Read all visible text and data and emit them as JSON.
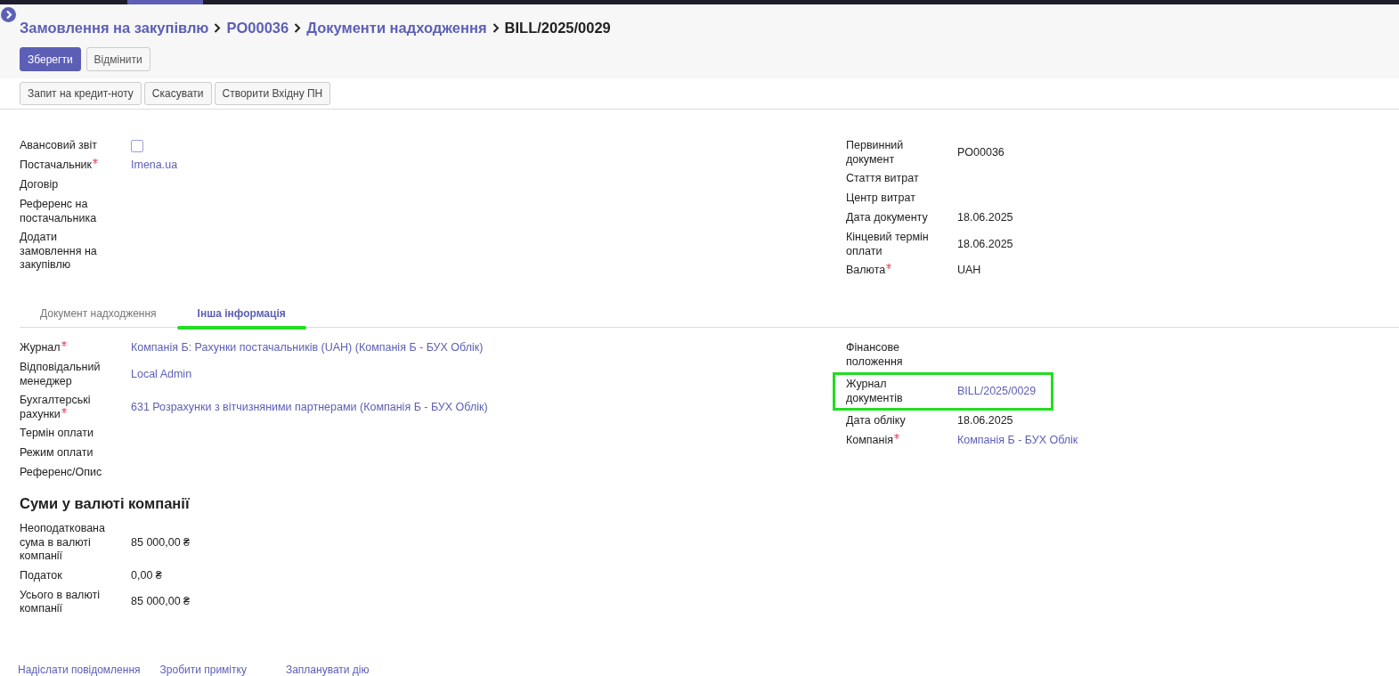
{
  "breadcrumbs": [
    {
      "label": "Замовлення на закупівлю",
      "kind": "link"
    },
    {
      "label": "PO00036",
      "kind": "link"
    },
    {
      "label": "Документи надходження",
      "kind": "link"
    },
    {
      "label": "BILL/2025/0029",
      "kind": "current"
    }
  ],
  "buttons": [
    {
      "label": "Зберегти",
      "primary": true
    },
    {
      "label": "Відмінити",
      "primary": false
    }
  ],
  "actions": [
    "Запит на кредит-ноту",
    "Скасувати",
    "Створити Вхідну ПН"
  ],
  "main_left": [
    {
      "label": "Авансовий звіт",
      "kind": "checkbox",
      "checked": false,
      "required": false
    },
    {
      "label": "Постачальник",
      "kind": "link",
      "value": "Imena.ua",
      "required": true
    },
    {
      "label": "Договір",
      "kind": "text",
      "required": false
    },
    {
      "label": "Референс на постачальника",
      "kind": "text",
      "required": false
    },
    {
      "label": "Додати замовлення на закупівлю",
      "kind": "text",
      "required": false
    }
  ],
  "main_right": [
    {
      "label": "Первинний документ",
      "kind": "text",
      "value": "PO00036",
      "required": false
    },
    {
      "label": "Стаття витрат",
      "kind": "text",
      "required": false
    },
    {
      "label": "Центр витрат",
      "kind": "text",
      "required": false
    },
    {
      "label": "Дата документу",
      "kind": "text",
      "value": "18.06.2025",
      "required": false
    },
    {
      "label": "Кінцевий термін оплати",
      "kind": "text",
      "value": "18.06.2025",
      "required": false
    },
    {
      "label": "Валюта",
      "kind": "text",
      "value": "UAH",
      "required": true
    }
  ],
  "tabs": [
    {
      "label": "Документ надходження",
      "selected": false
    },
    {
      "label": "Інша інформація",
      "selected": true
    }
  ],
  "other_left": [
    {
      "label": "Журнал",
      "kind": "link",
      "value": "Компанія Б: Рахунки постачальників (UAH) (Компанія Б - БУХ Облік)",
      "required": true
    },
    {
      "label": "Відповідальний менеджер",
      "kind": "link",
      "value": "Local Admin",
      "required": false
    },
    {
      "label": "Бухгалтерські рахунки",
      "kind": "link",
      "value": "631 Розрахунки з вітчизняними партнерами (Компанія Б - БУХ Облік)",
      "required": true
    },
    {
      "label": "Термін оплати",
      "kind": "text",
      "required": false
    },
    {
      "label": "Режим оплати",
      "kind": "text",
      "required": false
    },
    {
      "label": "Референс/Опис",
      "kind": "text",
      "required": false
    }
  ],
  "other_right": [
    {
      "label": "Фінансове положення",
      "kind": "text",
      "required": false
    },
    {
      "label": "Журнал документів",
      "kind": "link",
      "value": "BILL/2025/0029",
      "required": false,
      "highlighted": true
    },
    {
      "label": "Дата обліку",
      "kind": "text",
      "value": "18.06.2025",
      "required": false
    },
    {
      "label": "Компанія",
      "kind": "link",
      "value": "Компанія Б - БУХ Облік",
      "required": true
    }
  ],
  "totals": {
    "title": "Суми у валюті компанії",
    "rows": [
      {
        "label": "Неоподаткована сума в валюті компанії",
        "kind": "text",
        "value": "85 000,00 ₴",
        "required": false
      },
      {
        "label": "Податок",
        "kind": "text",
        "value": "0,00 ₴",
        "required": false
      },
      {
        "label": "Усього в валюті компанії",
        "kind": "text",
        "value": "85 000,00 ₴",
        "required": false
      }
    ]
  },
  "chatter": [
    "Надіслати повідомлення",
    "Зробити примітку",
    "Запланувати дію"
  ]
}
